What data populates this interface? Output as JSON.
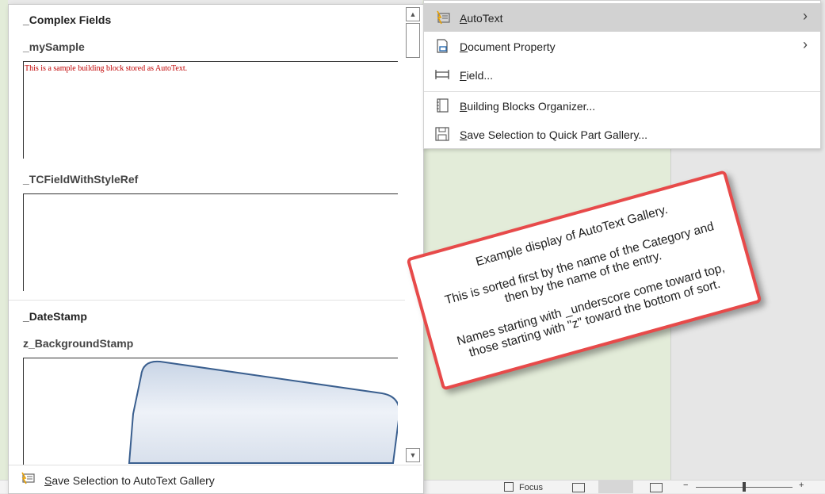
{
  "gallery": {
    "categories": [
      {
        "title": "_Complex Fields",
        "entries": [
          {
            "name": "_mySample",
            "preview_text": "This is a sample building block stored as AutoText."
          },
          {
            "name": "_TCFieldWithStyleRef",
            "preview_text": ""
          }
        ]
      },
      {
        "title": "_DateStamp",
        "entries": [
          {
            "name": "z_BackgroundStamp",
            "preview_text": ""
          }
        ]
      }
    ],
    "footer": {
      "label_accel": "S",
      "label_rest": "ave Selection to AutoText Gallery",
      "icon": "autotext-icon"
    }
  },
  "menu": {
    "items": [
      {
        "accel": "A",
        "rest": "utoText",
        "icon": "autotext-icon",
        "has_submenu": true,
        "highlighted": true
      },
      {
        "accel": "D",
        "rest": "ocument Property",
        "icon": "document-property-icon",
        "has_submenu": true
      },
      {
        "accel": "F",
        "rest": "ield...",
        "icon": "field-icon",
        "has_submenu": false
      },
      {
        "accel": "B",
        "rest": "uilding Blocks Organizer...",
        "icon": "building-blocks-icon",
        "has_submenu": false
      },
      {
        "accel": "S",
        "rest": "ave Selection to Quick Part Gallery...",
        "icon": "save-icon",
        "has_submenu": false
      }
    ]
  },
  "callout": {
    "line1": "Example display of AutoText Gallery.",
    "line2": "This is sorted first by the name of the Category and then by the name of the entry.",
    "line3": "Names starting with _underscore come toward top, those starting with \"z\" toward the bottom of sort."
  },
  "statusbar": {
    "focus_label": "Focus"
  },
  "colors": {
    "callout_border": "#e74a4a",
    "preview_text": "#c00000",
    "menu_highlight": "#d2d2d2",
    "document_bg": "#e3ecd9"
  }
}
